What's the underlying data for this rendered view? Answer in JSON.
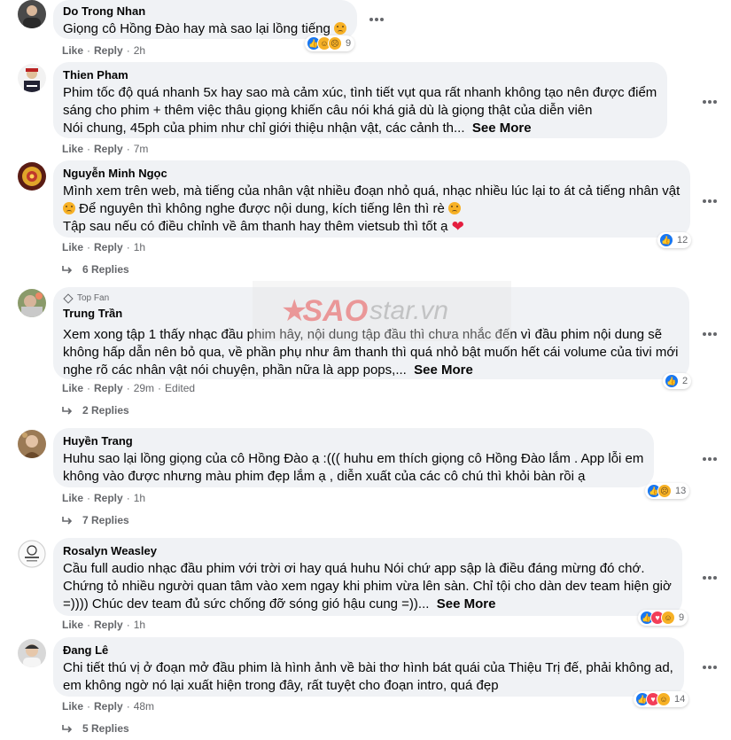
{
  "labels": {
    "like": "Like",
    "reply": "Reply",
    "see_more": "See More",
    "top_fan": "Top Fan"
  },
  "watermark": {
    "part1": "SAO",
    "part2": "star.vn"
  },
  "comments": [
    {
      "author": "Do Trong Nhan",
      "lines": [
        "Giọng cô Hồng Đào hay mà sao lại lồng tiếng"
      ],
      "time": "2h",
      "reactions": [
        "like",
        "haha",
        "sad"
      ],
      "reaction_count": "9"
    },
    {
      "author": "Thien Pham",
      "lines": [
        "Phim tốc độ quá nhanh 5x hay sao mà cảm xúc, tình tiết vụt qua rất nhanh không tạo nên được điểm",
        "sáng cho phim + thêm việc thâu giọng khiến câu nói khá giả dù là giọng thật của diễn viên",
        "Nói chung, 45ph của phim như chỉ giới thiệu nhận vật, các cảnh th..."
      ],
      "time": "7m"
    },
    {
      "author": "Nguyễn Minh Ngọc",
      "lines": [
        "Mình xem trên web, mà tiếng của nhân vật nhiều đoạn nhỏ quá, nhạc nhiều lúc lại to át cả tiếng nhân vật",
        "Để nguyên thì không nghe được nội dung, kích tiếng lên thì rè",
        "Tập sau nếu có điều chỉnh về âm thanh hay thêm vietsub thì tốt ạ"
      ],
      "time": "1h",
      "reactions": [
        "like"
      ],
      "reaction_count": "12",
      "replies": "6 Replies"
    },
    {
      "author": "Trung Trần",
      "lines": [
        "Xem xong tập 1 thấy nhạc đầu phim hây, nội dung tập đầu thì chưa nhắc đến vì đầu phim nội dung sẽ",
        "không hấp dẫn nên bỏ qua, về phần phụ như âm thanh thì quá nhỏ bật muốn hết cái volume của tivi mới",
        "nghe rõ các nhân vật nói chuyện, phần nữa là app pops,..."
      ],
      "time": "29m",
      "edited": "Edited",
      "reactions": [
        "like"
      ],
      "reaction_count": "2",
      "replies": "2 Replies"
    },
    {
      "author": "Huyền Trang",
      "lines": [
        "Huhu sao lại lồng giọng của cô Hồng Đào ạ :((( huhu em thích giọng cô Hồng Đào lắm . App lỗi em",
        "không vào được nhưng màu phim đẹp lắm ạ , diễn xuất của các cô chú thì khỏi bàn rồi ạ"
      ],
      "time": "1h",
      "reactions": [
        "like",
        "sad"
      ],
      "reaction_count": "13",
      "replies": "7 Replies"
    },
    {
      "author": "Rosalyn Weasley",
      "lines": [
        "Cầu full audio nhạc đầu phim với trời ơi hay quá huhu Nói chứ app sập là điều đáng mừng đó chớ.",
        "Chứng tỏ nhiều người quan tâm vào xem ngay khi phim vừa lên sàn. Chỉ tội cho dàn dev team hiện giờ",
        "=)))) Chúc dev team đủ sức chống đỡ sóng gió hậu cung =))..."
      ],
      "time": "1h",
      "reactions": [
        "like",
        "love",
        "haha"
      ],
      "reaction_count": "9"
    },
    {
      "author": "Đang Lê",
      "lines": [
        "Chi tiết thú vị ở đoạn mở đầu phim là hình ảnh về bài thơ hình bát quái của Thiệu Trị đế, phải không ad,",
        "em không ngờ nó lại xuất hiện trong đây, rất tuyệt cho đoạn intro, quá đẹp"
      ],
      "time": "48m",
      "reactions": [
        "like",
        "love",
        "haha"
      ],
      "reaction_count": "14",
      "replies": "5 Replies"
    }
  ],
  "icons": {
    "menu": "more-horizontal-icon",
    "reply_arrow": "reply-arrow-icon",
    "top_fan": "top-fan-diamond-icon"
  },
  "colors": {
    "bubble": "#f0f2f5",
    "muted": "#65676b",
    "like_blue": "#1877f2",
    "love_red": "#f33e58",
    "emoji_yellow": "#f7b125"
  }
}
